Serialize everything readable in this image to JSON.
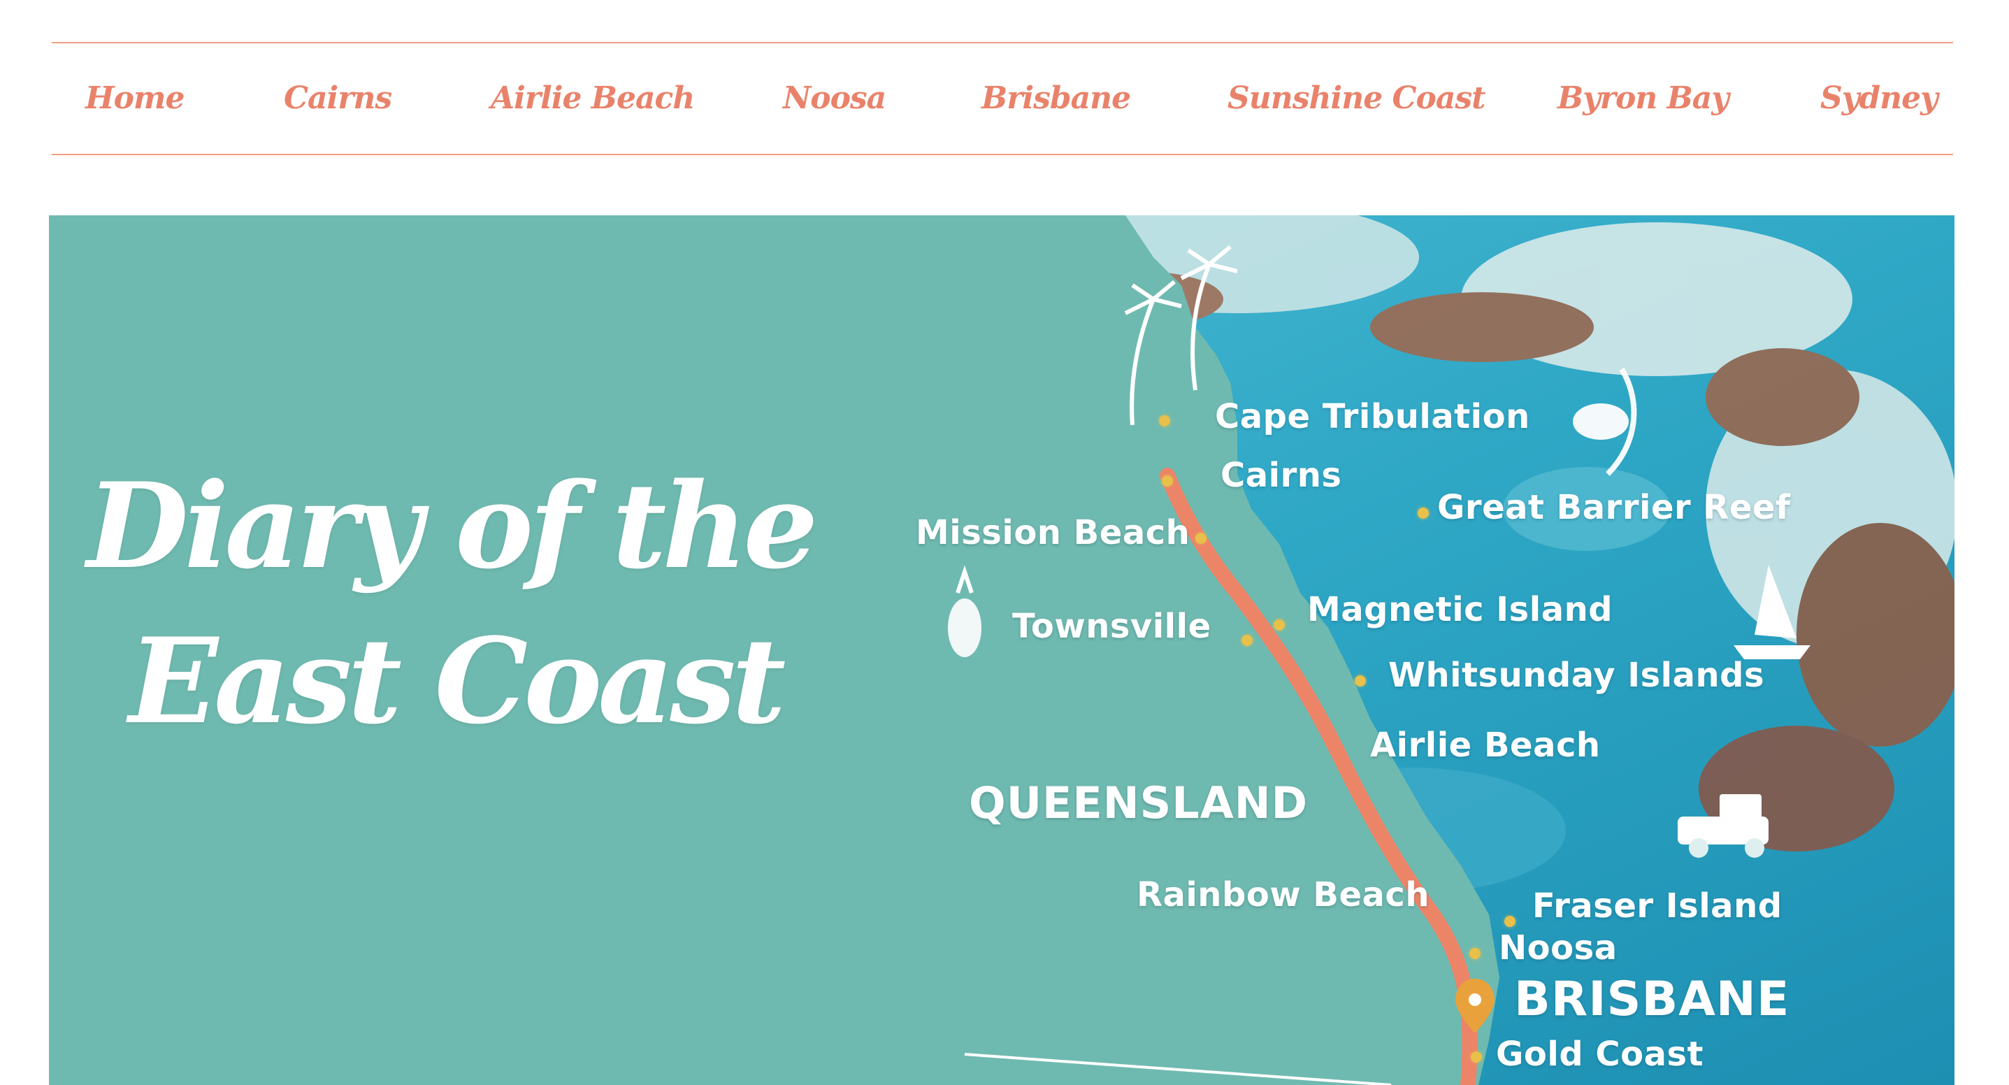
{
  "nav": {
    "items": [
      {
        "label": "Home"
      },
      {
        "label": "Cairns"
      },
      {
        "label": "Airlie Beach"
      },
      {
        "label": "Noosa"
      },
      {
        "label": "Brisbane"
      },
      {
        "label": "Sunshine Coast"
      },
      {
        "label": "Byron Bay"
      },
      {
        "label": "Sydney"
      }
    ]
  },
  "hero": {
    "title_line1": "Diary of the",
    "title_line2": "East Coast"
  },
  "map": {
    "labels": {
      "cape_tribulation": "Cape Tribulation",
      "cairns": "Cairns",
      "great_barrier_reef": "Great Barrier Reef",
      "mission_beach": "Mission Beach",
      "magnetic_island": "Magnetic Island",
      "townsville": "Townsville",
      "whitsunday_islands": "Whitsunday Islands",
      "airlie_beach": "Airlie Beach",
      "queensland": "QUEENSLAND",
      "rainbow_beach": "Rainbow Beach",
      "fraser_island": "Fraser Island",
      "noosa": "Noosa",
      "brisbane": "BRISBANE",
      "gold_coast": "Gold Coast"
    }
  },
  "colors": {
    "nav_text": "#e9826a",
    "nav_border": "#ef9f82",
    "land": "#6fbab0",
    "sea": "#2fa8c6",
    "route": "#ec8468",
    "marker": "#e8c04a"
  }
}
